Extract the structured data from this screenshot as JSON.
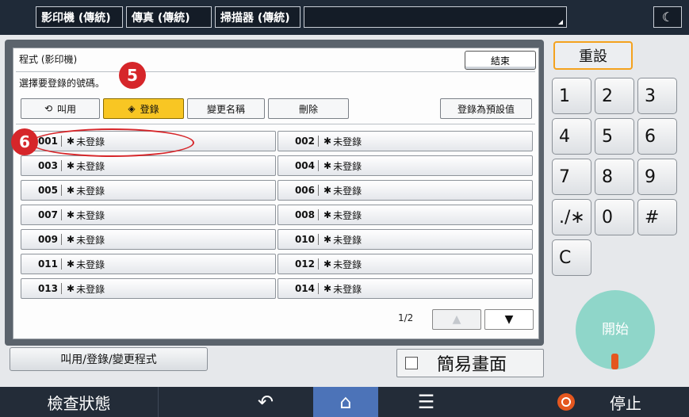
{
  "top_tabs": [
    {
      "label": "影印機 (傳統)"
    },
    {
      "label": "傳真 (傳統)"
    },
    {
      "label": "掃描器 (傳統)"
    }
  ],
  "dialog": {
    "title": "程式 (影印機)",
    "end_label": "結束",
    "prompt": "選擇要登錄的號碼。",
    "toolbar": {
      "recall": "叫用",
      "register": "登錄",
      "rename": "變更名稱",
      "delete": "刪除",
      "set_default": "登錄為預設值"
    },
    "programs": [
      {
        "num": "001",
        "label": "未登錄"
      },
      {
        "num": "002",
        "label": "未登錄"
      },
      {
        "num": "003",
        "label": "未登錄"
      },
      {
        "num": "004",
        "label": "未登錄"
      },
      {
        "num": "005",
        "label": "未登錄"
      },
      {
        "num": "006",
        "label": "未登錄"
      },
      {
        "num": "007",
        "label": "未登錄"
      },
      {
        "num": "008",
        "label": "未登錄"
      },
      {
        "num": "009",
        "label": "未登錄"
      },
      {
        "num": "010",
        "label": "未登錄"
      },
      {
        "num": "011",
        "label": "未登錄"
      },
      {
        "num": "012",
        "label": "未登錄"
      },
      {
        "num": "013",
        "label": "未登錄"
      },
      {
        "num": "014",
        "label": "未登錄"
      }
    ],
    "pager": "1/2"
  },
  "annotations": {
    "step5": "5",
    "step6": "6"
  },
  "bottom": {
    "program_button": "叫用/登錄/變更程式",
    "simple_screen": "簡易畫面"
  },
  "keypad": {
    "reset": "重設",
    "keys": [
      "1",
      "2",
      "3",
      "4",
      "5",
      "6",
      "7",
      "8",
      "9",
      "./∗",
      "0",
      "#",
      "C"
    ],
    "start": "開始"
  },
  "statusbar": {
    "check_status": "檢查狀態",
    "stop": "停止"
  },
  "colors": {
    "accent": "#f8c623",
    "annotation": "#d6262a",
    "start": "#8fd6c9",
    "stop": "#e4571f",
    "home": "#4c73b8"
  }
}
